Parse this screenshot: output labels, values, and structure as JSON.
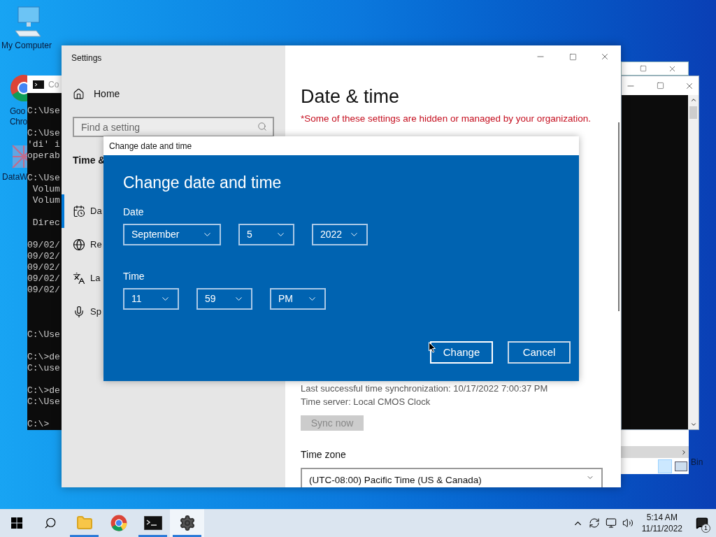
{
  "desktop_icons": [
    {
      "kind": "computer",
      "label_lines": [
        "My Computer"
      ]
    },
    {
      "kind": "chrome",
      "label_lines": [
        "Goo",
        "Chro"
      ]
    },
    {
      "kind": "app",
      "label_lines": [
        "DataW"
      ]
    }
  ],
  "recycle_bin": {
    "label": "Bin"
  },
  "console_window": {
    "title": "Co",
    "upper_blocks": [
      [
        "C:\\Use"
      ],
      [
        "C:\\Use",
        "'di' i",
        "operab"
      ],
      [
        "C:\\Use",
        " Volum",
        " Volum"
      ],
      [
        " Direc"
      ],
      [
        "09/02/",
        "09/02/",
        "09/02/",
        "09/02/",
        "09/02/"
      ]
    ],
    "lower_blocks": [
      [
        "C:\\Use"
      ],
      [
        "C:\\>de",
        "C:\\use"
      ],
      [
        "C:\\>de",
        "C:\\Use"
      ],
      [
        "C:\\>"
      ]
    ]
  },
  "settings_window": {
    "title": "Settings",
    "home": "Home",
    "search": {
      "placeholder": "Find a setting"
    },
    "section": "Time &",
    "nav": [
      {
        "label": "Da",
        "selected": true
      },
      {
        "label": "Re",
        "selected": false
      },
      {
        "label": "La",
        "selected": false
      },
      {
        "label": "Sp",
        "selected": false
      }
    ],
    "heading": "Date & time",
    "org_note": "*Some of these settings are hidden or managed by your organization.",
    "sync_info": [
      "Last successful time synchronization: 10/17/2022 7:00:37 PM",
      "Time server: Local CMOS Clock"
    ],
    "sync_button": {
      "label": "Sync now",
      "disabled": true
    },
    "time_zone_label": "Time zone",
    "time_zone": "(UTC-08:00) Pacific Time (US & Canada)"
  },
  "dialog": {
    "title": "Change date and time",
    "heading": "Change date and time",
    "sections": [
      {
        "label": "Date",
        "fields": [
          "September",
          "5",
          "2022"
        ]
      },
      {
        "label": "Time",
        "fields": [
          "11",
          "59",
          "PM"
        ]
      }
    ],
    "buttons": [
      {
        "label": "Change",
        "focused": true
      },
      {
        "label": "Cancel",
        "focused": false
      }
    ]
  },
  "taskbar": {
    "apps": [
      {
        "kind": "explorer",
        "running": true,
        "selected": false
      },
      {
        "kind": "chrome",
        "running": false,
        "selected": false
      },
      {
        "kind": "terminal",
        "running": true,
        "selected": false
      },
      {
        "kind": "settings",
        "running": true,
        "selected": true
      }
    ],
    "clock": {
      "time": "5:14 AM",
      "date": "11/11/2022"
    },
    "notification_count": "1"
  }
}
